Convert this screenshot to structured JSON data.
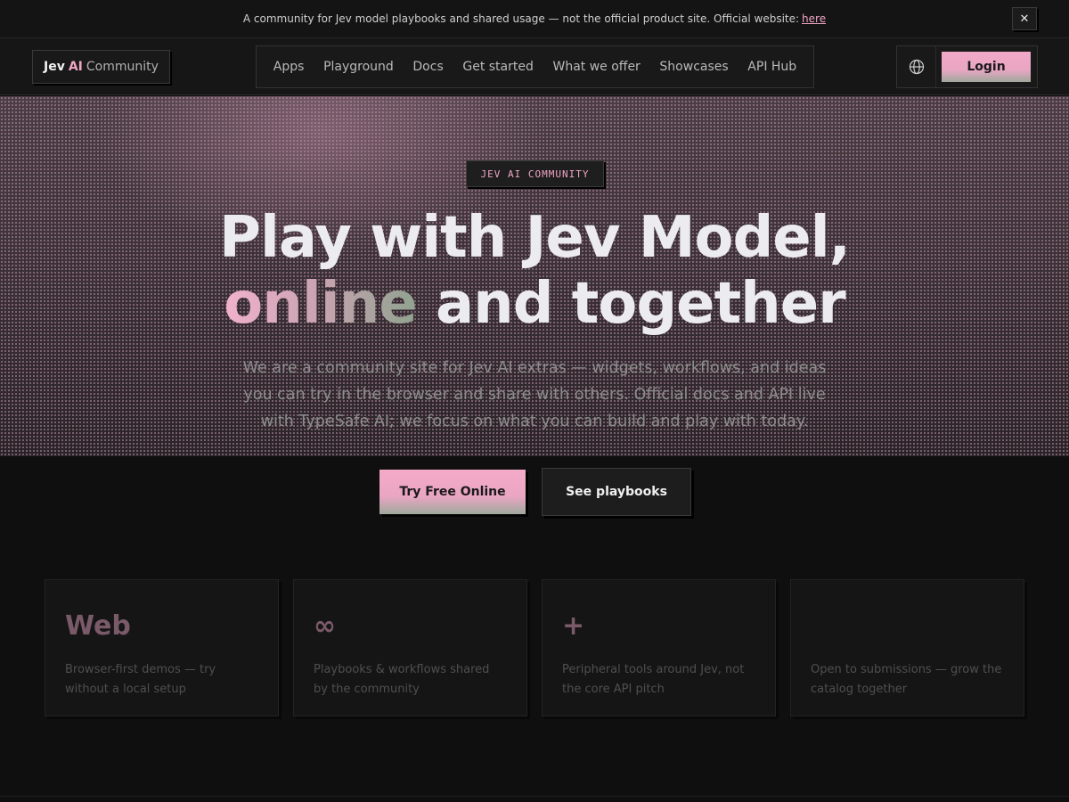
{
  "announcement": {
    "text": "A community for Jev model playbooks and shared usage — not the official product site. Official website:",
    "link": "here",
    "close": "✕"
  },
  "header": {
    "logo": {
      "part1": "Jev",
      "part2": "AI",
      "part3": "Community"
    },
    "nav": [
      "Apps",
      "Playground",
      "Docs",
      "Get started",
      "What we offer",
      "Showcases",
      "API Hub"
    ],
    "login": "Login"
  },
  "hero": {
    "badge": "JEV AI COMMUNITY",
    "headline_line1": "Play with Jev Model,",
    "headline_accent": "online",
    "headline_rest": " and together",
    "subtitle": "We are a community site for Jev AI extras — widgets, workflows, and ideas you can try in the browser and share with others. Official docs and API live with TypeSafe AI; we focus on what you can build and play with today.",
    "cta_primary": "Try Free Online",
    "cta_secondary": "See playbooks"
  },
  "features": [
    {
      "title": "Web",
      "desc": "Browser-first demos — try without a local setup"
    },
    {
      "title": "∞",
      "desc": "Playbooks & workflows shared by the community"
    },
    {
      "title": "+",
      "desc": "Peripheral tools around Jev, not the core API pitch"
    },
    {
      "title": "",
      "desc": "Open to submissions — grow the catalog together"
    }
  ],
  "colors": {
    "accent": "#f0a5c4",
    "background": "#0f0f0f"
  }
}
